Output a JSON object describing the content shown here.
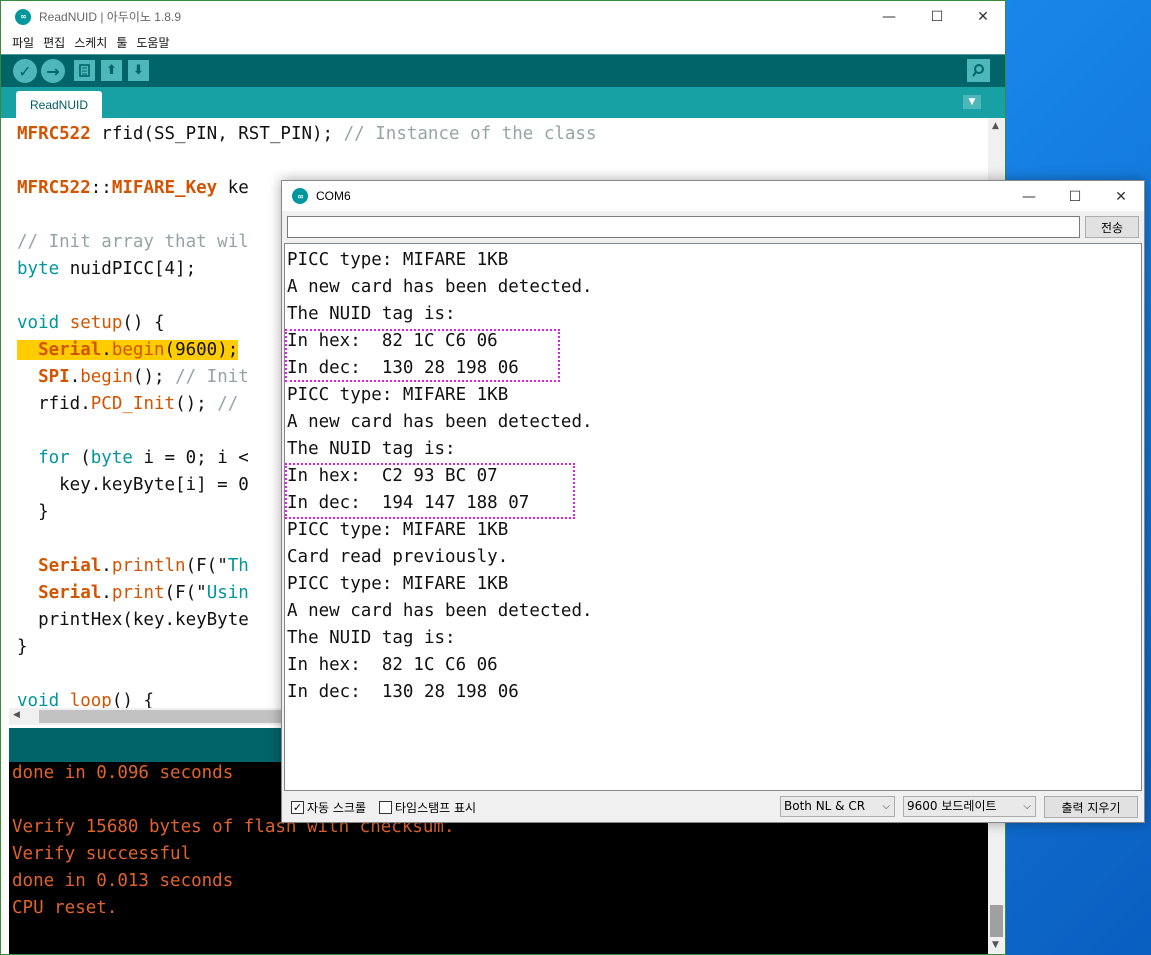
{
  "ide": {
    "title": "ReadNUID | 아두이노 1.8.9",
    "menu": [
      "파일",
      "편집",
      "스케치",
      "툴",
      "도움말"
    ],
    "tab": "ReadNUID",
    "code_lines": [
      {
        "segments": [
          {
            "t": "MFRC522",
            "c": "kw-orange"
          },
          {
            "t": " rfid(SS_PIN, RST_PIN); ",
            "c": ""
          },
          {
            "t": "// Instance of the class",
            "c": "comment"
          }
        ]
      },
      {
        "segments": []
      },
      {
        "segments": [
          {
            "t": "MFRC522",
            "c": "kw-orange"
          },
          {
            "t": "::",
            "c": ""
          },
          {
            "t": "MIFARE_Key",
            "c": "kw-orange"
          },
          {
            "t": " ke",
            "c": ""
          }
        ]
      },
      {
        "segments": []
      },
      {
        "segments": [
          {
            "t": "// Init array that wil",
            "c": "comment"
          }
        ]
      },
      {
        "segments": [
          {
            "t": "byte",
            "c": "kw-teal"
          },
          {
            "t": " nuidPICC[4];",
            "c": ""
          }
        ]
      },
      {
        "segments": []
      },
      {
        "segments": [
          {
            "t": "void",
            "c": "kw-teal"
          },
          {
            "t": " ",
            "c": ""
          },
          {
            "t": "setup",
            "c": "kw-orange-plain"
          },
          {
            "t": "() {",
            "c": ""
          }
        ]
      },
      {
        "segments": [
          {
            "t": "  ",
            "c": "hl"
          },
          {
            "t": "Serial",
            "c": "kw-orange hl"
          },
          {
            "t": ".",
            "c": "hl"
          },
          {
            "t": "begin",
            "c": "kw-orange-plain hl"
          },
          {
            "t": "(9600);",
            "c": "hl"
          }
        ]
      },
      {
        "segments": [
          {
            "t": "  ",
            "c": ""
          },
          {
            "t": "SPI",
            "c": "kw-orange"
          },
          {
            "t": ".",
            "c": ""
          },
          {
            "t": "begin",
            "c": "kw-orange-plain"
          },
          {
            "t": "(); ",
            "c": ""
          },
          {
            "t": "// Init",
            "c": "comment"
          }
        ]
      },
      {
        "segments": [
          {
            "t": "  rfid.",
            "c": ""
          },
          {
            "t": "PCD_Init",
            "c": "kw-orange-plain"
          },
          {
            "t": "(); ",
            "c": ""
          },
          {
            "t": "//",
            "c": "comment"
          }
        ]
      },
      {
        "segments": []
      },
      {
        "segments": [
          {
            "t": "  ",
            "c": ""
          },
          {
            "t": "for",
            "c": "kw-teal"
          },
          {
            "t": " (",
            "c": ""
          },
          {
            "t": "byte",
            "c": "kw-teal"
          },
          {
            "t": " i = 0; i <",
            "c": ""
          }
        ]
      },
      {
        "segments": [
          {
            "t": "    key.keyByte[i] = 0",
            "c": ""
          }
        ]
      },
      {
        "segments": [
          {
            "t": "  }",
            "c": ""
          }
        ]
      },
      {
        "segments": []
      },
      {
        "segments": [
          {
            "t": "  ",
            "c": ""
          },
          {
            "t": "Serial",
            "c": "kw-orange"
          },
          {
            "t": ".",
            "c": ""
          },
          {
            "t": "println",
            "c": "kw-orange-plain"
          },
          {
            "t": "(F(\"",
            "c": ""
          },
          {
            "t": "Th",
            "c": "kw-teal"
          }
        ]
      },
      {
        "segments": [
          {
            "t": "  ",
            "c": ""
          },
          {
            "t": "Serial",
            "c": "kw-orange"
          },
          {
            "t": ".",
            "c": ""
          },
          {
            "t": "print",
            "c": "kw-orange-plain"
          },
          {
            "t": "(F(\"",
            "c": ""
          },
          {
            "t": "Usin",
            "c": "kw-teal"
          }
        ]
      },
      {
        "segments": [
          {
            "t": "  printHex(key.keyByte",
            "c": ""
          }
        ]
      },
      {
        "segments": [
          {
            "t": "}",
            "c": ""
          }
        ]
      },
      {
        "segments": []
      },
      {
        "segments": [
          {
            "t": "void",
            "c": "kw-teal"
          },
          {
            "t": " ",
            "c": ""
          },
          {
            "t": "loop",
            "c": "kw-orange-plain"
          },
          {
            "t": "() {",
            "c": ""
          }
        ]
      }
    ],
    "console_lines": [
      "done in 0.096 seconds",
      "",
      "Verify 15680 bytes of flash with checksum.",
      "Verify successful",
      "done in 0.013 seconds",
      "CPU reset."
    ]
  },
  "serial": {
    "title": "COM6",
    "send_label": "전송",
    "send_value": "",
    "output_lines": [
      "PICC type: MIFARE 1KB",
      "A new card has been detected.",
      "The NUID tag is:",
      "In hex:  82 1C C6 06",
      "In dec:  130 28 198 06",
      "PICC type: MIFARE 1KB",
      "A new card has been detected.",
      "The NUID tag is:",
      "In hex:  C2 93 BC 07",
      "In dec:  194 147 188 07",
      "PICC type: MIFARE 1KB",
      "Card read previously.",
      "PICC type: MIFARE 1KB",
      "A new card has been detected.",
      "The NUID tag is:",
      "In hex:  82 1C C6 06",
      "In dec:  130 28 198 06"
    ],
    "autoscroll_label": "자동 스크롤",
    "autoscroll_checked": true,
    "timestamp_label": "타임스탬프 표시",
    "timestamp_checked": false,
    "line_ending": "Both NL & CR",
    "baud": "9600 보드레이트",
    "clear_label": "출력 지우기"
  },
  "colors": {
    "toolbar": "#006468",
    "tabbar": "#17a1a5",
    "highlight": "#ffcc00",
    "annotation_box": "#e020e0",
    "console_text": "#e0632e"
  }
}
